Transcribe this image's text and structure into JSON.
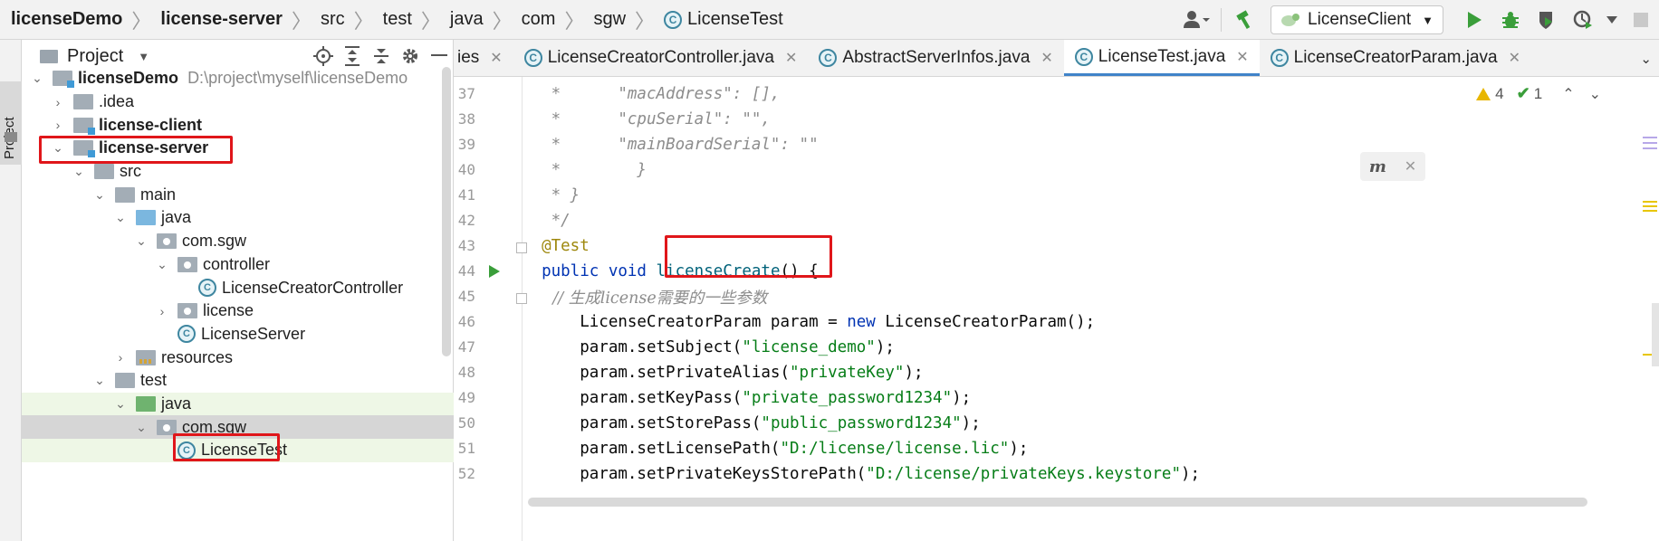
{
  "breadcrumb": [
    "licenseDemo",
    "license-server",
    "src",
    "test",
    "java",
    "com",
    "sgw"
  ],
  "breadcrumb_current": "LicenseTest",
  "class_icon_letter": "C",
  "run_config": {
    "label": "LicenseClient"
  },
  "project_panel": {
    "title": "Project"
  },
  "tree": [
    {
      "label": "licenseDemo",
      "path": "D:\\project\\myself\\licenseDemo"
    },
    {
      "label": ".idea"
    },
    {
      "label": "license-client"
    },
    {
      "label": "license-server"
    },
    {
      "label": "src"
    },
    {
      "label": "main"
    },
    {
      "label": "java"
    },
    {
      "label": "com.sgw"
    },
    {
      "label": "controller"
    },
    {
      "label": "LicenseCreatorController"
    },
    {
      "label": "license"
    },
    {
      "label": "LicenseServer"
    },
    {
      "label": "resources"
    },
    {
      "label": "test"
    },
    {
      "label": "java"
    },
    {
      "label": "com.sgw"
    },
    {
      "label": "LicenseTest"
    }
  ],
  "tabs": [
    {
      "label": "ies"
    },
    {
      "label": "LicenseCreatorController.java"
    },
    {
      "label": "AbstractServerInfos.java"
    },
    {
      "label": "LicenseTest.java"
    },
    {
      "label": "LicenseCreatorParam.java"
    }
  ],
  "inspections": {
    "warnings": "4",
    "ok": "1"
  },
  "code_lines": [
    {
      "num": "37",
      "tokens": [
        {
          "t": "   *      \"macAddress\": [],",
          "c": "c-comment"
        }
      ]
    },
    {
      "num": "38",
      "tokens": [
        {
          "t": "   *      \"cpuSerial\": \"\",",
          "c": "c-comment"
        }
      ]
    },
    {
      "num": "39",
      "tokens": [
        {
          "t": "   *      \"mainBoardSerial\": \"\"",
          "c": "c-comment"
        }
      ]
    },
    {
      "num": "40",
      "tokens": [
        {
          "t": "   *        }",
          "c": "c-comment"
        }
      ]
    },
    {
      "num": "41",
      "tokens": [
        {
          "t": "   * }",
          "c": "c-comment"
        }
      ]
    },
    {
      "num": "42",
      "tokens": [
        {
          "t": "   */",
          "c": "c-comment"
        }
      ]
    },
    {
      "num": "43",
      "tokens": [
        {
          "t": "  @Test",
          "c": "c-annot"
        }
      ]
    },
    {
      "num": "44",
      "tokens": [
        {
          "t": "  public void ",
          "c": "c-kw"
        },
        {
          "t": "licenseCreate",
          "c": "c-fn"
        },
        {
          "t": "() {",
          "c": "c-plain"
        }
      ]
    },
    {
      "num": "45",
      "tokens": [
        {
          "t": "      // 生成license需要的一些参数",
          "c": "c-comment-cn"
        }
      ]
    },
    {
      "num": "46",
      "tokens": [
        {
          "t": "      LicenseCreatorParam param = ",
          "c": "c-plain"
        },
        {
          "t": "new",
          "c": "c-kw"
        },
        {
          "t": " LicenseCreatorParam();",
          "c": "c-plain"
        }
      ]
    },
    {
      "num": "47",
      "tokens": [
        {
          "t": "      param.setSubject(",
          "c": "c-plain"
        },
        {
          "t": "\"license_demo\"",
          "c": "c-str"
        },
        {
          "t": ");",
          "c": "c-plain"
        }
      ]
    },
    {
      "num": "48",
      "tokens": [
        {
          "t": "      param.setPrivateAlias(",
          "c": "c-plain"
        },
        {
          "t": "\"privateKey\"",
          "c": "c-str"
        },
        {
          "t": ");",
          "c": "c-plain"
        }
      ]
    },
    {
      "num": "49",
      "tokens": [
        {
          "t": "      param.setKeyPass(",
          "c": "c-plain"
        },
        {
          "t": "\"private_password1234\"",
          "c": "c-str"
        },
        {
          "t": ");",
          "c": "c-plain"
        }
      ]
    },
    {
      "num": "50",
      "tokens": [
        {
          "t": "      param.setStorePass(",
          "c": "c-plain"
        },
        {
          "t": "\"public_password1234\"",
          "c": "c-str"
        },
        {
          "t": ");",
          "c": "c-plain"
        }
      ]
    },
    {
      "num": "51",
      "tokens": [
        {
          "t": "      param.setLicensePath(",
          "c": "c-plain"
        },
        {
          "t": "\"D:/license/license.lic\"",
          "c": "c-str"
        },
        {
          "t": ");",
          "c": "c-plain"
        }
      ]
    },
    {
      "num": "52",
      "tokens": [
        {
          "t": "      param.setPrivateKeysStorePath(",
          "c": "c-plain"
        },
        {
          "t": "\"D:/license/privateKeys.keystore\"",
          "c": "c-str"
        },
        {
          "t": ");",
          "c": "c-plain"
        }
      ]
    }
  ],
  "colors": {
    "accent_tab": "#4083c9",
    "annotation_box": "#e0161a",
    "run_green": "#3a9e3a"
  }
}
